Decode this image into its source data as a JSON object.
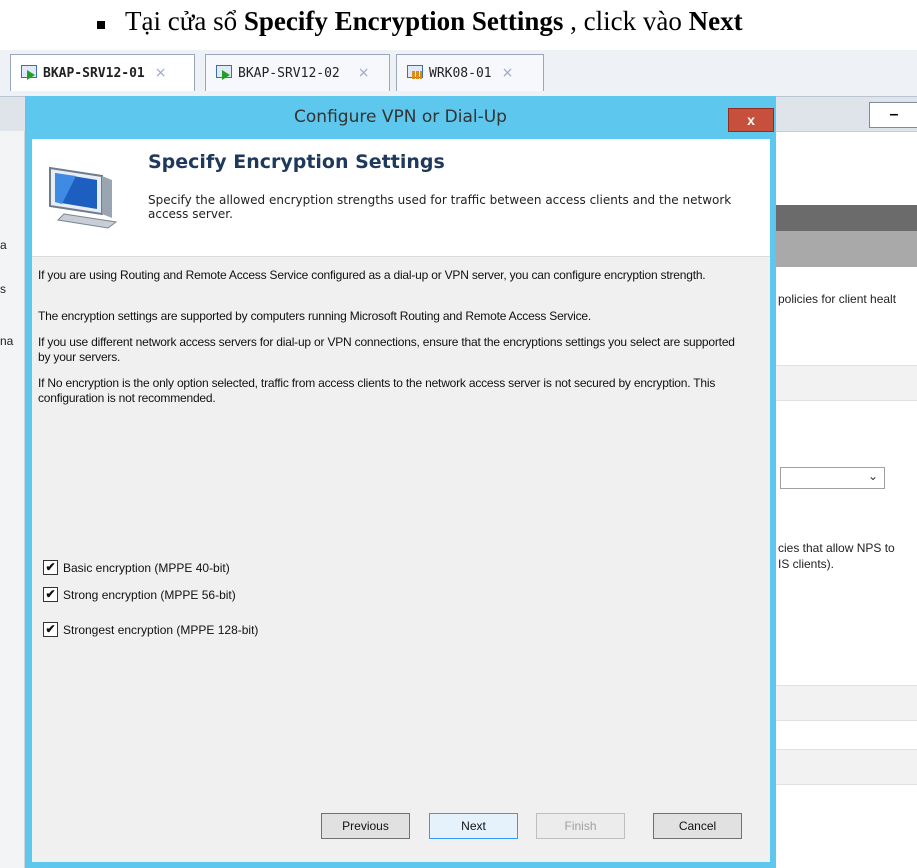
{
  "doc": {
    "prefix": "Tại cửa sổ ",
    "strong1": "Specify Encryption Settings",
    "middle": " , click vào ",
    "strong2": "Next"
  },
  "tabs": [
    {
      "label": "BKAP-SRV12-01",
      "close": "×",
      "icon": "vm-running-icon",
      "active": true
    },
    {
      "label": "BKAP-SRV12-02",
      "close": "×",
      "icon": "vm-running-icon",
      "active": false
    },
    {
      "label": "WRK08-01",
      "close": "×",
      "icon": "vm-paused-icon",
      "active": false
    }
  ],
  "background": {
    "minimize": "–",
    "fragments": [
      "a",
      "s",
      "na",
      "policies for client healt",
      "cies that allow NPS to",
      "IS clients)."
    ],
    "select_caret": "⌄"
  },
  "dialog": {
    "title": "Configure VPN or Dial-Up",
    "close": "x",
    "header": {
      "title": "Specify Encryption Settings",
      "subtitle": "Specify the allowed encryption strengths used for traffic between access clients and the network access server."
    },
    "paragraphs": [
      "If you are using Routing and Remote Access Service configured as a dial-up or VPN server, you can configure encryption strength.",
      "The encryption settings are supported by computers running Microsoft Routing and Remote Access Service.",
      "If you use different network access servers for dial-up or VPN connections, ensure that the encryptions settings you select are supported by your servers.",
      "If No encryption is the only option selected, traffic from access clients to the network access server is not secured by encryption. This configuration is not recommended."
    ],
    "options": [
      {
        "label": "Basic encryption (MPPE 40-bit)",
        "checked": true
      },
      {
        "label": "Strong encryption (MPPE 56-bit)",
        "checked": true
      },
      {
        "label": "Strongest encryption (MPPE 128-bit)",
        "checked": true
      }
    ],
    "check_mark": "✔",
    "buttons": {
      "previous": "Previous",
      "next": "Next",
      "finish": "Finish",
      "cancel": "Cancel"
    }
  }
}
